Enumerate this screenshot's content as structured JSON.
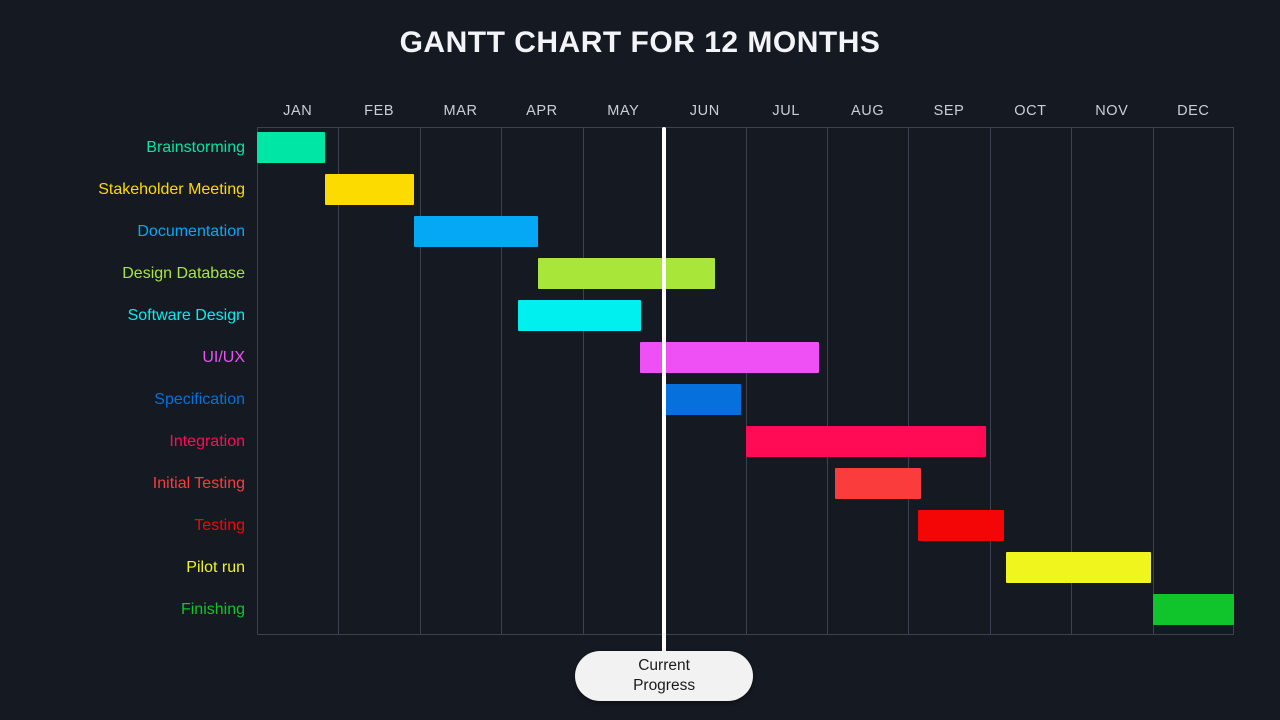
{
  "title": "GANTT CHART FOR 12 MONTHS",
  "progress_marker": {
    "line1": "Current",
    "line2": "Progress",
    "at_month": "JUN"
  },
  "chart_data": {
    "type": "bar",
    "title": "GANTT CHART FOR 12 MONTHS",
    "xlabel": "",
    "ylabel": "",
    "orientation": "horizontal",
    "grid": true,
    "legend": "none",
    "categories": [
      "JAN",
      "FEB",
      "MAR",
      "APR",
      "MAY",
      "JUN",
      "JUL",
      "AUG",
      "SEP",
      "OCT",
      "NOV",
      "DEC"
    ],
    "month_index": {
      "JAN": 0,
      "FEB": 1,
      "MAR": 2,
      "APR": 3,
      "MAY": 4,
      "JUN": 5,
      "JUL": 6,
      "AUG": 7,
      "SEP": 8,
      "OCT": 9,
      "NOV": 10,
      "DEC": 11
    },
    "current_progress_month": "JUN",
    "current_progress_x": 5.0,
    "background": "#151a22",
    "grid_color": "#3c4250",
    "tasks": [
      {
        "label": "Brainstorming",
        "color": "#00e6a4",
        "start": 0.0,
        "end": 0.84
      },
      {
        "label": "Stakeholder Meeting",
        "color": "#fcdb00",
        "start": 0.84,
        "end": 1.93
      },
      {
        "label": "Documentation",
        "color": "#05a8f5",
        "start": 1.93,
        "end": 3.45
      },
      {
        "label": "Design Database",
        "color": "#a8e63a",
        "start": 3.45,
        "end": 5.62
      },
      {
        "label": "Software Design",
        "color": "#00f0f0",
        "start": 3.2,
        "end": 4.72
      },
      {
        "label": "UI/UX",
        "color": "#ee50f5",
        "start": 4.7,
        "end": 6.9
      },
      {
        "label": "Specification",
        "color": "#0670dd",
        "start": 5.0,
        "end": 5.95
      },
      {
        "label": "Integration",
        "color": "#ff0a55",
        "start": 6.0,
        "end": 8.95
      },
      {
        "label": "Initial Testing",
        "color": "#fa3c3c",
        "start": 7.1,
        "end": 8.15
      },
      {
        "label": "Testing",
        "color": "#f50606",
        "start": 8.12,
        "end": 9.17
      },
      {
        "label": "Pilot run",
        "color": "#f0f51e",
        "start": 9.2,
        "end": 10.98
      },
      {
        "label": "Finishing",
        "color": "#10c42b",
        "start": 11.0,
        "end": 12.0
      }
    ]
  }
}
